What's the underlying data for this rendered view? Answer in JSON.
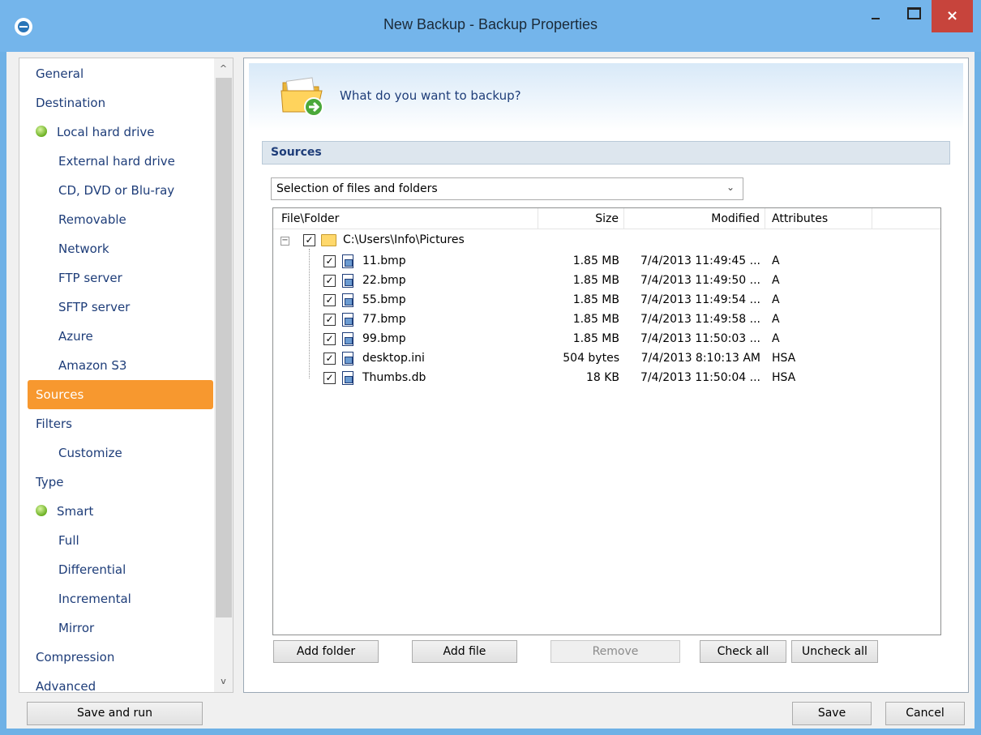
{
  "window": {
    "title": "New Backup - Backup Properties",
    "close_label": "×"
  },
  "nav": {
    "items": [
      {
        "label": "General"
      },
      {
        "label": "Destination"
      },
      {
        "label": "Local hard drive"
      },
      {
        "label": "External hard drive"
      },
      {
        "label": "CD, DVD or Blu-ray"
      },
      {
        "label": "Removable"
      },
      {
        "label": "Network"
      },
      {
        "label": "FTP server"
      },
      {
        "label": "SFTP server"
      },
      {
        "label": "Azure"
      },
      {
        "label": "Amazon S3"
      },
      {
        "label": "Sources"
      },
      {
        "label": "Filters"
      },
      {
        "label": "Customize"
      },
      {
        "label": "Type"
      },
      {
        "label": "Smart"
      },
      {
        "label": "Full"
      },
      {
        "label": "Differential"
      },
      {
        "label": "Incremental"
      },
      {
        "label": "Mirror"
      },
      {
        "label": "Compression"
      },
      {
        "label": "Advanced"
      }
    ],
    "scroll_up": "^",
    "scroll_down": "v"
  },
  "panel": {
    "question": "What do you want to backup?",
    "section_title": "Sources",
    "source_type": "Selection of files and folders",
    "columns": {
      "file": "File\\Folder",
      "size": "Size",
      "modified": "Modified",
      "attributes": "Attributes"
    },
    "root": {
      "name": "C:\\Users\\Info\\Pictures",
      "checked": true
    },
    "files": [
      {
        "name": "11.bmp",
        "size": "1.85 MB",
        "modified": "7/4/2013 11:49:45 ...",
        "attributes": "A",
        "checked": true
      },
      {
        "name": "22.bmp",
        "size": "1.85 MB",
        "modified": "7/4/2013 11:49:50 ...",
        "attributes": "A",
        "checked": true
      },
      {
        "name": "55.bmp",
        "size": "1.85 MB",
        "modified": "7/4/2013 11:49:54 ...",
        "attributes": "A",
        "checked": true
      },
      {
        "name": "77.bmp",
        "size": "1.85 MB",
        "modified": "7/4/2013 11:49:58 ...",
        "attributes": "A",
        "checked": true
      },
      {
        "name": "99.bmp",
        "size": "1.85 MB",
        "modified": "7/4/2013 11:50:03 ...",
        "attributes": "A",
        "checked": true
      },
      {
        "name": "desktop.ini",
        "size": "504 bytes",
        "modified": "7/4/2013 8:10:13 AM",
        "attributes": "HSA",
        "checked": true
      },
      {
        "name": "Thumbs.db",
        "size": "18 KB",
        "modified": "7/4/2013 11:50:04 ...",
        "attributes": "HSA",
        "checked": true
      }
    ],
    "buttons": {
      "add_folder": "Add folder",
      "add_file": "Add file",
      "remove": "Remove",
      "check_all": "Check all",
      "uncheck_all": "Uncheck all"
    }
  },
  "footer": {
    "save_and_run": "Save and run",
    "save": "Save",
    "cancel": "Cancel"
  },
  "colors": {
    "active_nav": "#f7982f",
    "nav_text": "#1e3d79",
    "titlebar": "#74b5eb",
    "close_button": "#c7443c"
  }
}
